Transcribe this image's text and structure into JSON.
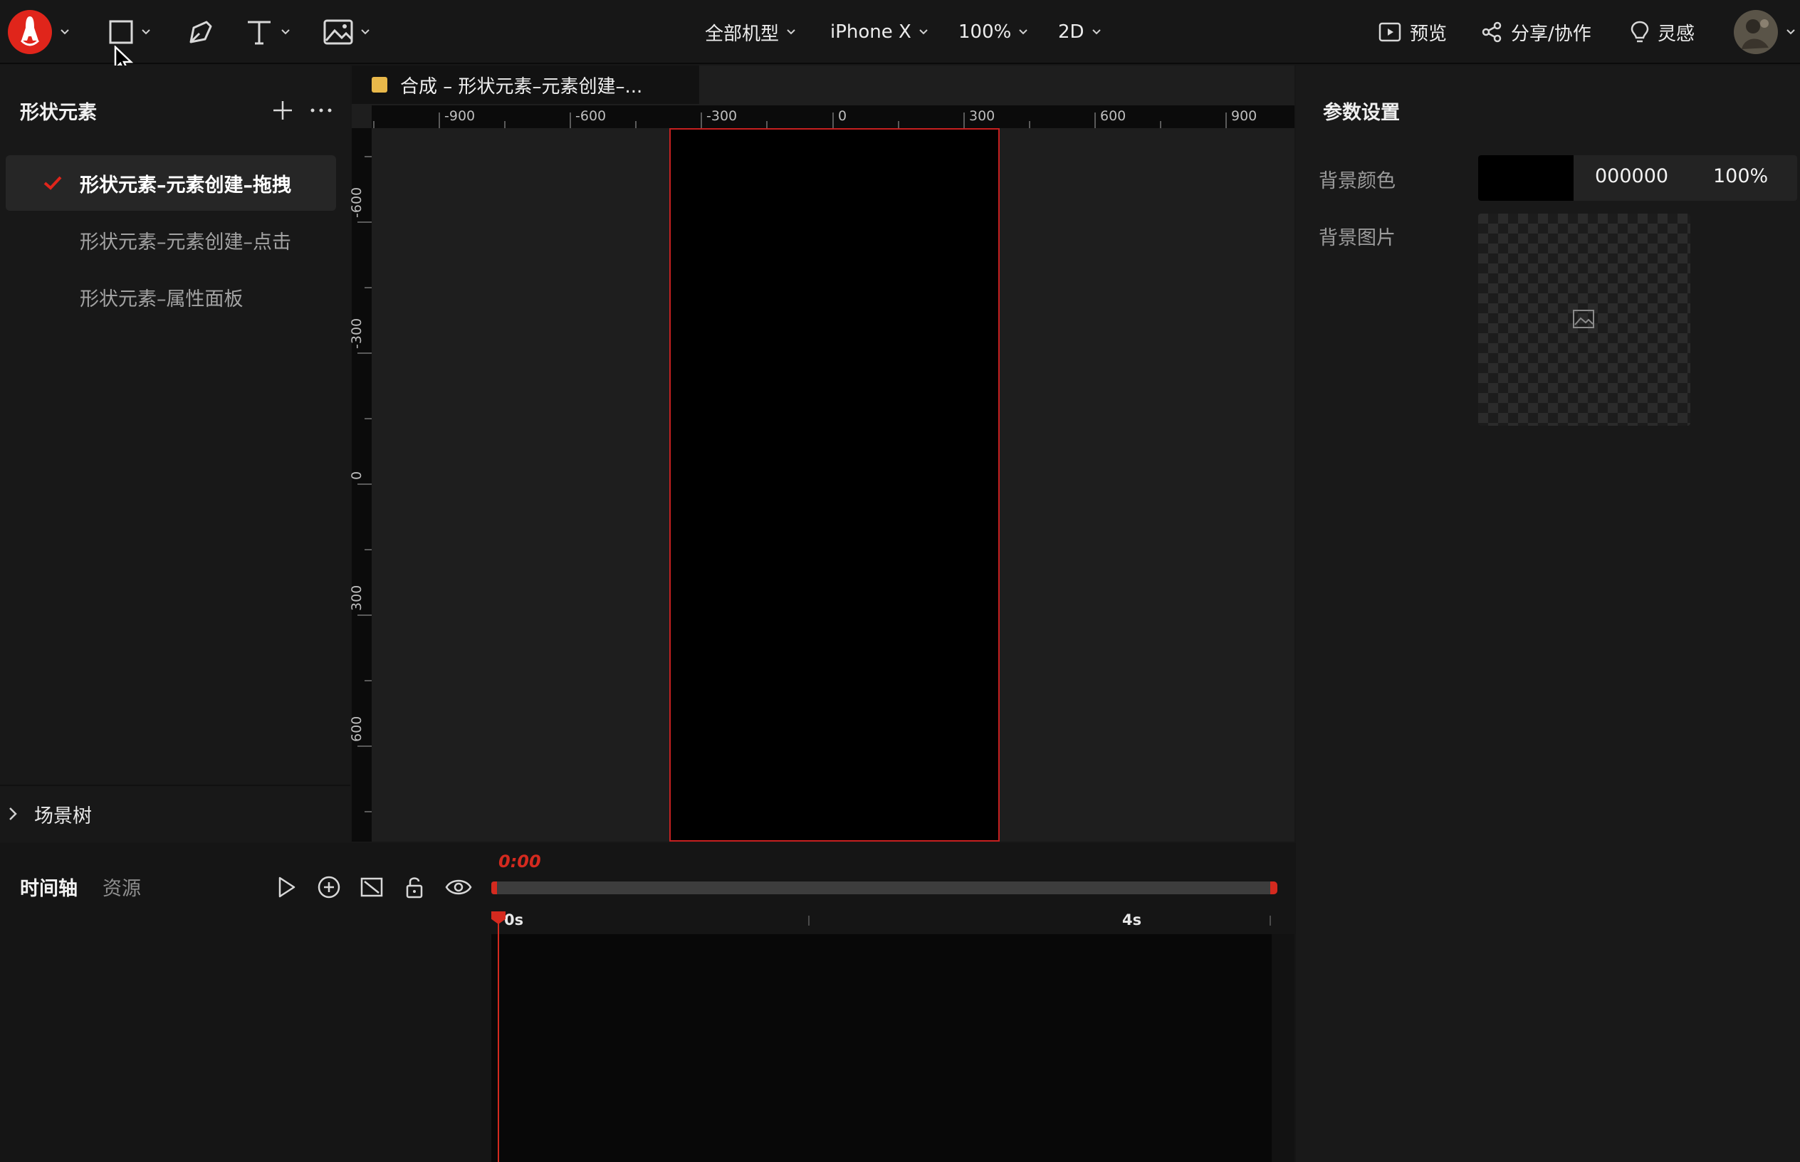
{
  "toolbar": {
    "menus": {
      "models": "全部机型",
      "device": "iPhone X",
      "zoom": "100%",
      "mode": "2D"
    },
    "preview_label": "预览",
    "share_label": "分享/协作",
    "inspiration_label": "灵感"
  },
  "left_panel": {
    "title": "形状元素",
    "scenes": [
      {
        "label": "形状元素–元素创建–拖拽",
        "active": true
      },
      {
        "label": "形状元素–元素创建–点击",
        "active": false
      },
      {
        "label": "形状元素–属性面板",
        "active": false
      }
    ],
    "scene_tree_label": "场景树"
  },
  "canvas": {
    "tab_title": "合成 – 形状元素–元素创建–...",
    "tab_color": "#e8b84a",
    "ruler_x": [
      "-900",
      "-600",
      "-300",
      "0",
      "300",
      "600",
      "900"
    ],
    "ruler_y": [
      "-600",
      "-300",
      "0",
      "300",
      "600"
    ],
    "artboard_border_color": "#c62020"
  },
  "right_panel": {
    "title": "参数设置",
    "bg_color_label": "背景颜色",
    "bg_color_value": "000000",
    "bg_opacity": "100%",
    "bg_image_label": "背景图片"
  },
  "timeline": {
    "tab_timeline": "时间轴",
    "tab_assets": "资源",
    "current_time": "0:00",
    "ticks": [
      "0s",
      "4s"
    ],
    "accent_color": "#d42a1f"
  }
}
